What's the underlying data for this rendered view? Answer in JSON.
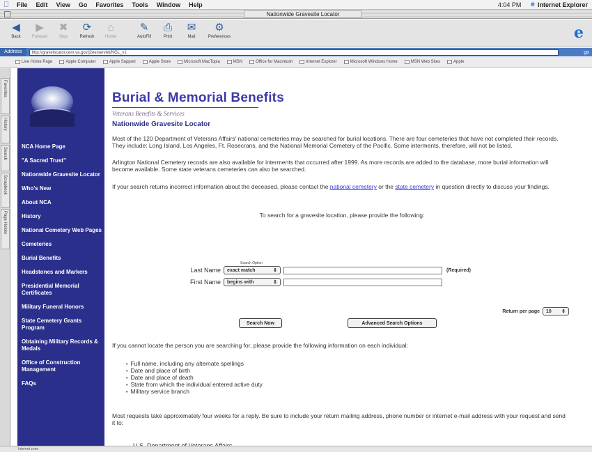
{
  "menubar": {
    "items": [
      "File",
      "Edit",
      "View",
      "Go",
      "Favorites",
      "Tools",
      "Window",
      "Help"
    ],
    "clock": "4:04 PM",
    "app": "Internet Explorer"
  },
  "window": {
    "title": "Nationwide Gravesite Locator"
  },
  "toolbar": {
    "buttons": [
      {
        "label": "Back",
        "icon": "back-arrow-icon"
      },
      {
        "label": "Forward",
        "icon": "forward-arrow-icon"
      },
      {
        "label": "Stop",
        "icon": "stop-icon"
      },
      {
        "label": "Refresh",
        "icon": "refresh-icon"
      },
      {
        "label": "Home",
        "icon": "home-icon"
      },
      {
        "label": "AutoFill",
        "icon": "autofill-icon"
      },
      {
        "label": "Print",
        "icon": "print-icon"
      },
      {
        "label": "Mail",
        "icon": "mail-icon"
      },
      {
        "label": "Preferences",
        "icon": "preferences-icon"
      }
    ]
  },
  "address": {
    "label": "Address",
    "url": "http://gravelocator.cem.va.gov/j2ee/servlet/NGL_v1",
    "go": "go"
  },
  "favorites": [
    "Live Home Page",
    "Apple Computer",
    "Apple Support",
    "Apple Store",
    "Microsoft MacTopia",
    "MSN",
    "Office for Macintosh",
    "Internet Explorer",
    "Microsoft Windows Home",
    "MSN Web Sites",
    "Apple"
  ],
  "explorer_tabs": [
    "Favorites",
    "History",
    "Search",
    "Scrapbook",
    "Page Holder"
  ],
  "sidebar": {
    "nav": [
      "NCA Home Page",
      "\"A Sacred Trust\"",
      "Nationwide Gravesite Locator",
      "Who's New",
      "About NCA",
      "History",
      "National Cemetery Web Pages",
      "Cemeteries",
      "Burial Benefits",
      "Headstones and Markers",
      "Presidential Memorial Certificates",
      "Military Funeral Honors",
      "State Cemetery Grants Program",
      "Obtaining Military Records & Medals",
      "Office of Construction Management",
      "FAQs"
    ]
  },
  "content": {
    "title": "Burial & Memorial Benefits",
    "subtitle": "Veterans Benefits & Services",
    "heading": "Nationwide Gravesite Locator",
    "para1": "Most of the 120 Department of Veterans Affairs' national cemeteries may be searched for burial locations. There are four cemeteries that have not completed their records. They include: Long Island, Los Angeles, Ft. Rosecrans, and the National Memorial Cemetery of the Pacific. Some interments, therefore, will not be listed.",
    "para2": "Arlington National Cemetery records are also available for interments that occurred after 1999. As more records are added to the database, more burial information will become available. Some state veterans cemeteries can also be searched.",
    "para3_a": "If your search returns incorrect information about the deceased, please contact the ",
    "link_national": "national cemetery",
    "para3_b": " or the ",
    "link_state": "state cemetery",
    "para3_c": " in question directly to discuss your findings.",
    "prompt": "To search for a gravesite location, please provide the following:",
    "search_option_label": "Search Option",
    "last_name_label": "Last Name",
    "last_name_option": "exact match",
    "first_name_label": "First Name",
    "first_name_option": "begins with",
    "required": "(Required)",
    "results_label": "Return per page",
    "results_value": "10",
    "search_button": "Search Now",
    "advanced_button": "Advanced Search Options",
    "para4": "If you cannot locate the person you are searching for, please provide the following information on each individual:",
    "bullets": [
      "Full name, including any alternate spellings",
      "Date and place of birth",
      "Date and place of death",
      "State from which the individual entered active duty",
      "Military service branch"
    ],
    "para5": "Most requests take approximately four weeks for a reply. Be sure to include your return mailing address, phone number or internet e-mail address with your request and send it to:",
    "address_line": "U.S. Department of Veterans Affairs"
  },
  "status": "Internet zone",
  "colors": {
    "sidebar": "#2b2f8c",
    "title": "#3a3aa8",
    "link": "#3a3ad0"
  }
}
